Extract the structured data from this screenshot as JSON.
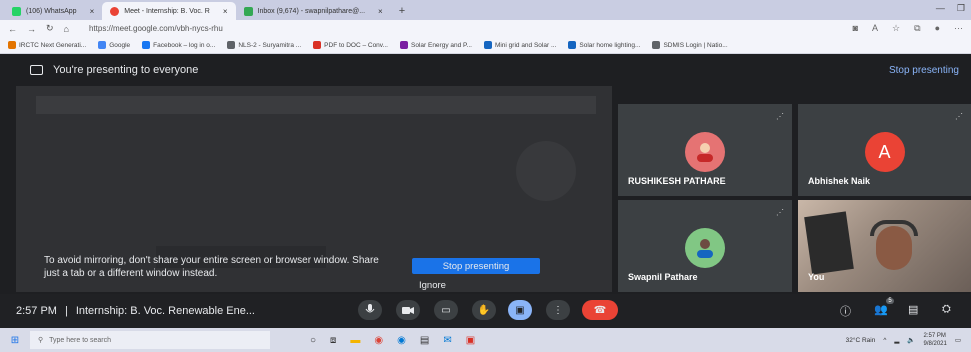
{
  "browser": {
    "tabs": [
      {
        "label": "(106) WhatsApp",
        "color": "#25d366"
      },
      {
        "label": "Meet - Internship: B. Voc. R",
        "color": "#ea4335"
      },
      {
        "label": "Inbox (9,674) - swapnilpathare@...",
        "color": "#34a853"
      }
    ],
    "new_tab_icon": "+",
    "url": "https://meet.google.com/vbh-nycs-rhu",
    "bookmarks": [
      {
        "label": "IRCTC Next Generati...",
        "color": "#e37400"
      },
      {
        "label": "Google",
        "color": "#4285f4"
      },
      {
        "label": "Facebook – log in o...",
        "color": "#1877f2"
      },
      {
        "label": "NLS-2 - Suryamitra ...",
        "color": "#5f6368"
      },
      {
        "label": "PDF to DOC – Conv...",
        "color": "#d93025"
      },
      {
        "label": "Solar Energy and P...",
        "color": "#7b1fa2"
      },
      {
        "label": "Mini grid and Solar ...",
        "color": "#1565c0"
      },
      {
        "label": "Solar home lighting...",
        "color": "#1565c0"
      },
      {
        "label": "SDMIS Login | Natio...",
        "color": "#5f6368"
      }
    ]
  },
  "meet": {
    "banner_text": "You're presenting to everyone",
    "banner_stop": "Stop presenting",
    "warning_text": "To avoid mirroring, don't share your entire screen or browser window. Share just a tab or a different window instead.",
    "stop_button": "Stop presenting",
    "ignore_button": "Ignore",
    "participants": [
      {
        "name": "RUSHIKESH PATHARE",
        "avatar_color": "#e57373"
      },
      {
        "name": "Abhishek Naik",
        "avatar_letter": "A",
        "avatar_color": "#ea4335"
      },
      {
        "name": "Swapnil Pathare",
        "avatar_color": "#81c784"
      },
      {
        "name": "You"
      }
    ],
    "time": "2:57 PM",
    "separator": "|",
    "meeting_title": "Internship: B. Voc. Renewable Ene...",
    "participant_count": "5"
  },
  "taskbar": {
    "search_placeholder": "Type here to search",
    "weather": "32°C Rain",
    "clock_time": "2:57 PM",
    "clock_date": "9/8/2021"
  }
}
